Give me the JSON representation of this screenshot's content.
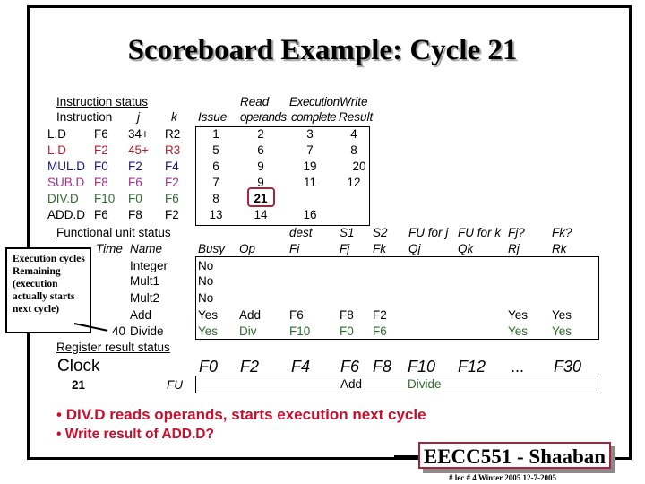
{
  "title": "Scoreboard Example:  Cycle 21",
  "instruction_status": {
    "heading": "Instruction status",
    "headers": {
      "instruction": "Instruction",
      "j": "j",
      "k": "k",
      "issue": "Issue",
      "read_top": "Read",
      "read_bottom": "operands",
      "exec_top": "Execution",
      "exec_bottom": "complete",
      "write_top": "Write",
      "write_bottom": "Result"
    },
    "rows": [
      {
        "op": "L.D",
        "dest": "F6",
        "j": "34+",
        "k": "R2",
        "issue": "1",
        "read": "2",
        "exec": "3",
        "write": "4",
        "color": "#000000"
      },
      {
        "op": "L.D",
        "dest": "F2",
        "j": "45+",
        "k": "R3",
        "issue": "5",
        "read": "6",
        "exec": "7",
        "write": "8",
        "color": "#a8242f"
      },
      {
        "op": "MUL.D",
        "dest": "F0",
        "j": "F2",
        "k": "F4",
        "issue": "6",
        "read": "9",
        "exec": "19",
        "write": "20",
        "color": "#1a1a7a"
      },
      {
        "op": "SUB.D",
        "dest": "F8",
        "j": "F6",
        "k": "F2",
        "issue": "7",
        "read": "9",
        "exec": "11",
        "write": "12",
        "color": "#a0308c"
      },
      {
        "op": "DIV.D",
        "dest": "F10",
        "j": "F0",
        "k": "F6",
        "issue": "8",
        "read": "21",
        "exec": "",
        "write": "",
        "color": "#2e6a2e"
      },
      {
        "op": "ADD.D",
        "dest": "F6",
        "j": "F8",
        "k": "F2",
        "issue": "13",
        "read": "14",
        "exec": "16",
        "write": "",
        "color": "#000000"
      }
    ],
    "highlighted_value": "21"
  },
  "functional_unit_status": {
    "heading": "Functional unit status",
    "headers": {
      "time": "Time",
      "name": "Name",
      "busy": "Busy",
      "op": "Op",
      "fi_top": "dest",
      "fi_bottom": "Fi",
      "fj_top": "S1",
      "fj_bottom": "Fj",
      "fk_top": "S2",
      "fk_bottom": "Fk",
      "qj_top": "FU for j",
      "qj_bottom": "Qj",
      "qk_top": "FU for k",
      "qk_bottom": "Qk",
      "rj_top": "Fj?",
      "rj_bottom": "Rj",
      "rk_top": "Fk?",
      "rk_bottom": "Rk"
    },
    "rows": [
      {
        "time": "",
        "name": "Integer",
        "busy": "No",
        "op": "",
        "fi": "",
        "fj": "",
        "fk": "",
        "qj": "",
        "qk": "",
        "rj": "",
        "rk": "",
        "color": "#000000"
      },
      {
        "time": "",
        "name": "Mult1",
        "busy": "No",
        "op": "",
        "fi": "",
        "fj": "",
        "fk": "",
        "qj": "",
        "qk": "",
        "rj": "",
        "rk": "",
        "color": "#000000"
      },
      {
        "time": "",
        "name": "Mult2",
        "busy": "No",
        "op": "",
        "fi": "",
        "fj": "",
        "fk": "",
        "qj": "",
        "qk": "",
        "rj": "",
        "rk": "",
        "color": "#000000"
      },
      {
        "time": "",
        "name": "Add",
        "busy": "Yes",
        "op": "Add",
        "fi": "F6",
        "fj": "F8",
        "fk": "F2",
        "qj": "",
        "qk": "",
        "rj": "Yes",
        "rk": "Yes",
        "color": "#000000"
      },
      {
        "time": "40",
        "name": "Divide",
        "busy": "Yes",
        "op": "Div",
        "fi": "F10",
        "fj": "F0",
        "fk": "F6",
        "qj": "",
        "qk": "",
        "rj": "Yes",
        "rk": "Yes",
        "color": "#2e6a2e"
      }
    ]
  },
  "annotation": {
    "text": "Execution cycles Remaining (execution actually starts next cycle)"
  },
  "register_result_status": {
    "heading": "Register result status",
    "clock_label": "Clock",
    "clock_value": "21",
    "fu_label": "FU",
    "registers": [
      "F0",
      "F2",
      "F4",
      "F6",
      "F8",
      "F10",
      "F12",
      "...",
      "F30"
    ],
    "values": [
      "",
      "",
      "",
      "Add",
      "",
      "Divide",
      "",
      "",
      ""
    ],
    "value_colors": [
      "#000000",
      "#000000",
      "#000000",
      "#000000",
      "#000000",
      "#2e6a2e",
      "#000000",
      "#000000",
      "#000000"
    ]
  },
  "bullets": [
    "DIV.D reads operands, starts execution next cycle",
    "Write result of ADD.D?"
  ],
  "badge": "EECC551 - Shaaban",
  "footer": "#  lec # 4  Winter 2005    12-7-2005"
}
